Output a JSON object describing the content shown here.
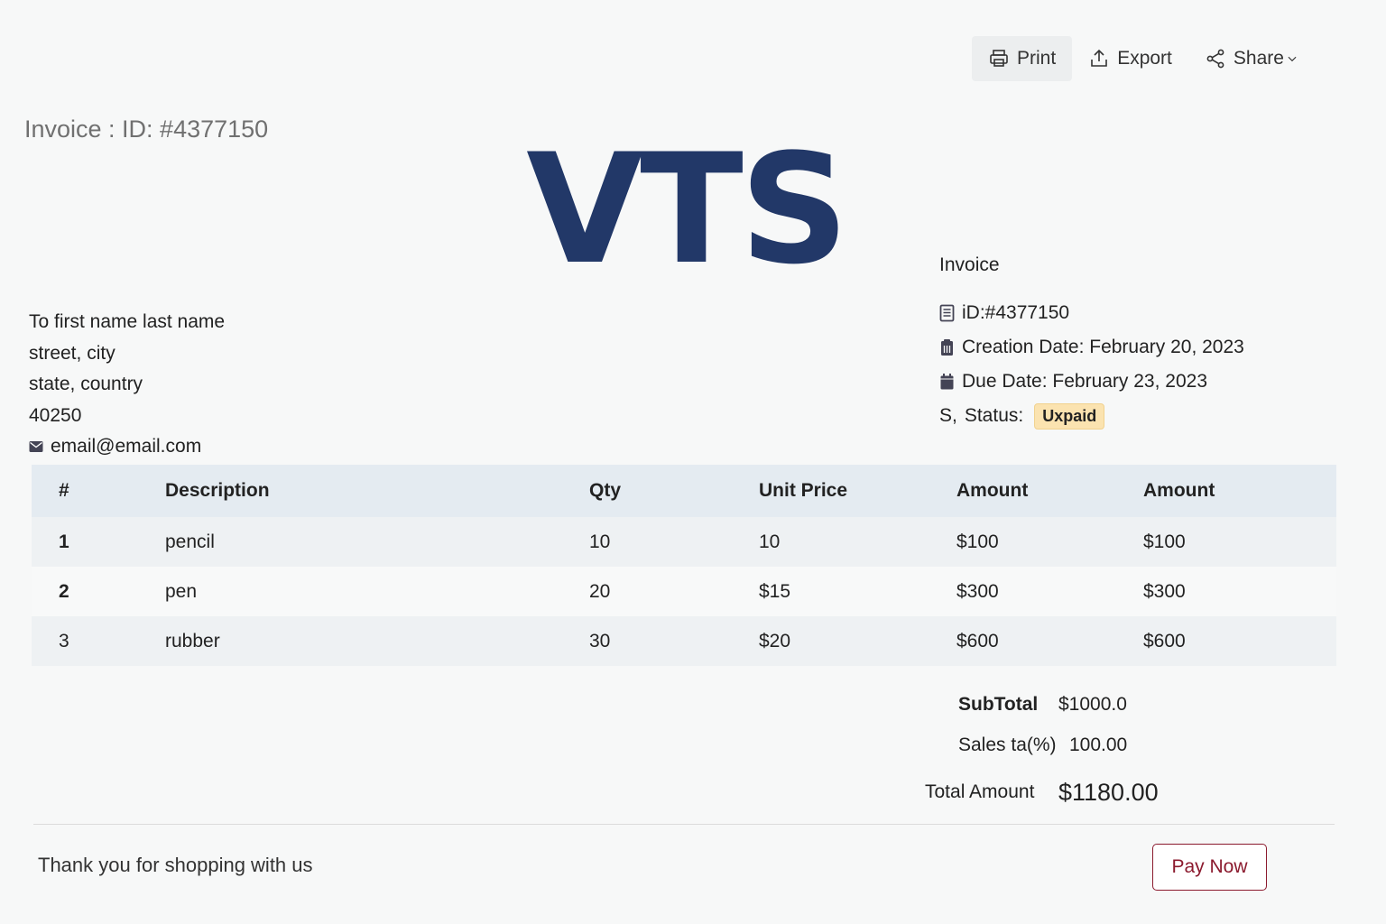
{
  "toolbar": {
    "print_label": "Print",
    "export_label": "Export",
    "share_label": "Share"
  },
  "page_title": "Invoice : ID: #4377150",
  "logo_text": "VTS",
  "bill_to": {
    "name": "To first name last name",
    "street": "street, city",
    "state": "state, country",
    "zip": "40250",
    "email": "email@email.com"
  },
  "invoice_meta": {
    "title": "Invoice",
    "id": "iD:#4377150",
    "creation_date": "Creation Date: February 20, 2023",
    "due_date": "Due Date: February 23, 2023",
    "status_prefix": "S,",
    "status_label": "Status:",
    "status_value": "Uxpaid",
    "status_color": "#fbe3b0"
  },
  "table": {
    "headers": [
      "#",
      "Description",
      "Qty",
      "Unit Price",
      "Amount",
      "Amount"
    ],
    "rows": [
      {
        "num": "1",
        "desc": "pencil",
        "qty": "10",
        "unit": "10",
        "amount": "$100",
        "amount2": "$100"
      },
      {
        "num": "2",
        "desc": "pen",
        "qty": "20",
        "unit": "$15",
        "amount": "$300",
        "amount2": "$300"
      },
      {
        "num": "3",
        "desc": "rubber",
        "qty": "30",
        "unit": "$20",
        "amount": "$600",
        "amount2": "$600"
      }
    ]
  },
  "totals": {
    "subtotal_label": "SubTotal",
    "subtotal_value": "$1000.0",
    "tax_label": "Sales ta(%)",
    "tax_value": "100.00",
    "total_label": "Total Amount",
    "total_value": "$1180.00"
  },
  "footer": {
    "thanks": "Thank you for shopping with us",
    "pay_label": "Pay Now"
  },
  "colors": {
    "logo": "#223868",
    "pay_button": "#8b1a2e",
    "table_header": "#e4ebf1"
  }
}
